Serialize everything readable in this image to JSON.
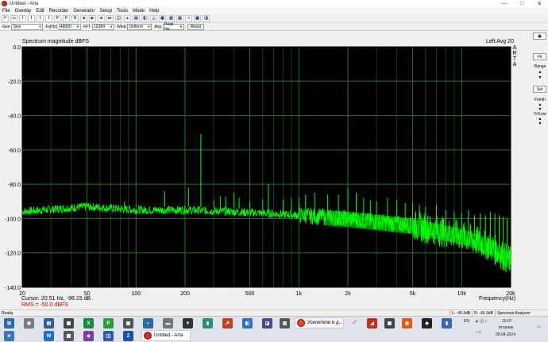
{
  "window": {
    "title": "Untitled - Arta",
    "controls": [
      "—",
      "□",
      "✕"
    ]
  },
  "menu": [
    "File",
    "Overlay",
    "Edit",
    "Recorder",
    "Generator",
    "Setup",
    "Tools",
    "Mode",
    "Help"
  ],
  "toolbar": {
    "buttons": [
      "↶",
      "▭",
      "I",
      "I",
      "I",
      "I",
      "F",
      "F",
      "S",
      "■",
      "▶",
      "■",
      "▸▸",
      "◫",
      "▲",
      "▤",
      "◧",
      "△",
      "▦",
      "▧",
      "▨",
      "≡",
      "▩",
      "◨"
    ]
  },
  "controls": {
    "gen_label": "Gen",
    "gen_value": "Sine",
    "fs_label": "Fs[Hz]",
    "fs_value": "48000",
    "fft_label": "FFT",
    "fft_value": "16384",
    "wind_label": "Wind",
    "wind_value": "Uniform",
    "avg_label": "Avg",
    "avg_value": "Peak Ho",
    "reset_label": "Reset"
  },
  "plot": {
    "title": "Spectrum magnitude dBFS",
    "meta": "Left  Avg 20",
    "arta_letters": [
      "A",
      "R",
      "T",
      "A"
    ],
    "cursor": "Cursor: 20.51 Hz, -96.15 dB",
    "rms": "RMS = -50.0 dBFS",
    "xlabel": "Frequency(Hz)"
  },
  "side_panel": {
    "top_btn": "Fit",
    "range_label": "Range",
    "set_btn": "Set",
    "fsmooth_label": "Fsmth",
    "fhilow_label": "Fr/Low",
    "up": "▲",
    "down": "▼"
  },
  "chart_data": {
    "type": "line",
    "title": "Spectrum magnitude dBFS",
    "xlabel": "Frequency(Hz)",
    "ylabel": "",
    "x_scale": "log",
    "xlim": [
      20,
      20000
    ],
    "ylim": [
      -140,
      0
    ],
    "x_ticks": [
      20,
      50,
      100,
      200,
      500,
      1000,
      2000,
      5000,
      10000,
      20000
    ],
    "x_tick_labels": [
      "20",
      "50",
      "100",
      "200",
      "500",
      "1k",
      "2k",
      "5k",
      "10k",
      "20k"
    ],
    "y_ticks": [
      0,
      -20,
      -40,
      -60,
      -80,
      -100,
      -120,
      -140
    ],
    "y_tick_labels": [
      "0.0",
      "-20.0",
      "-40.0",
      "-60.0",
      "-80.0",
      "-100.0",
      "-120.0",
      "-140.0"
    ],
    "grid": true,
    "background": "#000000",
    "grid_color": "#2f6f2f",
    "series": [
      {
        "color": "#00ff00",
        "noise_floor": [
          [
            20,
            -96
          ],
          [
            50,
            -93
          ],
          [
            100,
            -95
          ],
          [
            200,
            -95
          ],
          [
            400,
            -96
          ],
          [
            1000,
            -98
          ],
          [
            2000,
            -100
          ],
          [
            5000,
            -104
          ],
          [
            10000,
            -110
          ],
          [
            15000,
            -116
          ],
          [
            20000,
            -125
          ]
        ],
        "peaks": [
          [
            50,
            -92
          ],
          [
            85,
            -90
          ],
          [
            100,
            -92
          ],
          [
            150,
            -84
          ],
          [
            210,
            -82
          ],
          [
            250,
            -51
          ],
          [
            300,
            -89
          ],
          [
            330,
            -87
          ],
          [
            355,
            -87
          ],
          [
            400,
            -85
          ],
          [
            430,
            -88
          ],
          [
            500,
            -90
          ],
          [
            600,
            -89
          ],
          [
            650,
            -80
          ],
          [
            800,
            -89
          ],
          [
            900,
            -88
          ],
          [
            1000,
            -88
          ],
          [
            1100,
            -86
          ],
          [
            1250,
            -85
          ],
          [
            1500,
            -86
          ],
          [
            1750,
            -86
          ],
          [
            2000,
            -82
          ],
          [
            2250,
            -85
          ],
          [
            2500,
            -88
          ],
          [
            2750,
            -89
          ],
          [
            3000,
            -90
          ],
          [
            3500,
            -88
          ],
          [
            4000,
            -89
          ],
          [
            4500,
            -91
          ],
          [
            5000,
            -91
          ],
          [
            5500,
            -92
          ],
          [
            6000,
            -93
          ],
          [
            7000,
            -92
          ],
          [
            8000,
            -95
          ],
          [
            9000,
            -96
          ],
          [
            10000,
            -97
          ],
          [
            11000,
            -95
          ],
          [
            12000,
            -98
          ],
          [
            13000,
            -97
          ],
          [
            14000,
            -98
          ],
          [
            15000,
            -96
          ],
          [
            16000,
            -97
          ],
          [
            17000,
            -98
          ],
          [
            18000,
            -99
          ],
          [
            19000,
            -100
          ]
        ]
      }
    ]
  },
  "status": {
    "left": "Ready",
    "l_level": "L: -46.3dB",
    "r_level": "R: -46.3dB",
    "mode": "Spectrum Analyzer"
  },
  "taskbar": {
    "window1": "Усилители и д...",
    "window2": "Untitled - Arta",
    "lang": "EN",
    "time": "15:07",
    "day": "вторник",
    "date": "09.04.2024"
  }
}
